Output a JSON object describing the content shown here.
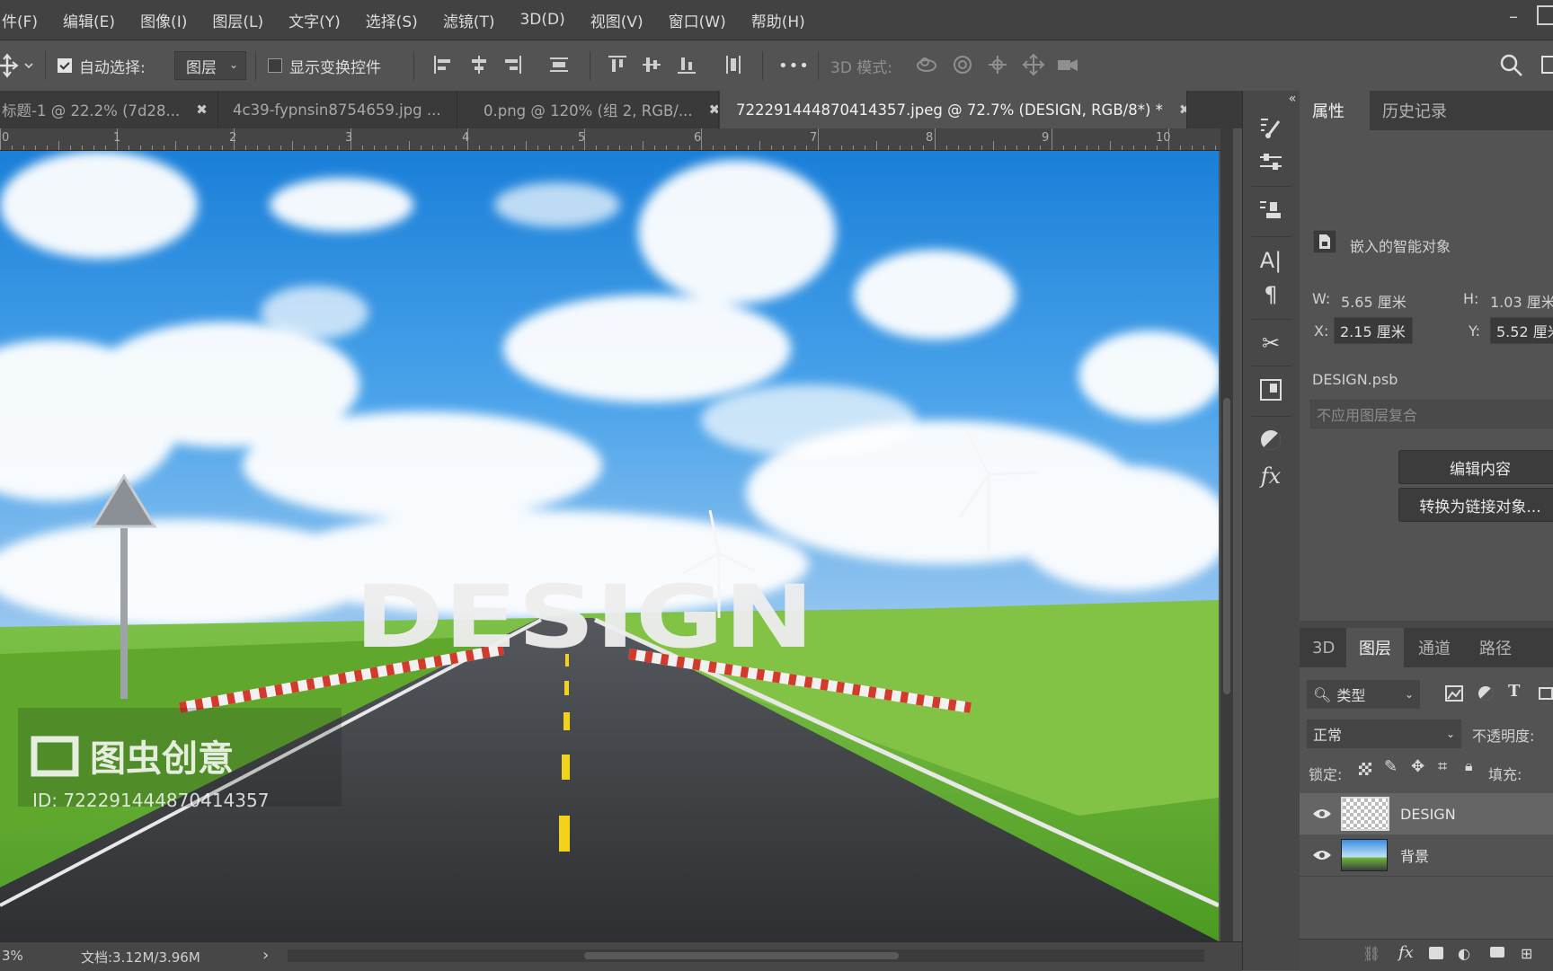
{
  "menu": [
    "件(F)",
    "编辑(E)",
    "图像(I)",
    "图层(L)",
    "文字(Y)",
    "选择(S)",
    "滤镜(T)",
    "3D(D)",
    "视图(V)",
    "窗口(W)",
    "帮助(H)"
  ],
  "options": {
    "auto_select_label": "自动选择:",
    "auto_select_checked": true,
    "target_value": "图层",
    "show_transform_label": "显示变换控件",
    "more_label": "•••",
    "mode_3d_label": "3D 模式:"
  },
  "tabs": [
    {
      "label": "标题-1 @ 22.2% (7d28...",
      "active": false
    },
    {
      "label": "4c39-fypnsin8754659.jpg ...",
      "active": false
    },
    {
      "label": "0.png @ 120% (组 2, RGB/...",
      "active": false
    },
    {
      "label": "722291444870414357.jpeg @ 72.7% (DESIGN, RGB/8*) *",
      "active": true
    }
  ],
  "ruler_numbers": [
    "0",
    "1",
    "2",
    "3",
    "4",
    "5",
    "6",
    "7",
    "8",
    "9",
    "10"
  ],
  "canvas": {
    "road_text": "DESIGN",
    "watermark_brand": "图虫创意",
    "watermark_id": "ID: 722291444870414357"
  },
  "properties_panel": {
    "tab_properties": "属性",
    "tab_history": "历史记录",
    "object_type": "嵌入的智能对象",
    "w_label": "W:",
    "w_value": "5.65 厘米",
    "h_label": "H:",
    "h_value": "1.03 厘米",
    "x_label": "X:",
    "x_value": "2.15 厘米",
    "y_label": "Y:",
    "y_value": "5.52 厘米",
    "file_name": "DESIGN.psb",
    "comp_placeholder": "不应用图层复合",
    "edit_contents_button": "编辑内容",
    "convert_linked_button": "转换为链接对象..."
  },
  "layers_panel": {
    "tabs": [
      "3D",
      "图层",
      "通道",
      "路径"
    ],
    "active_tab": "图层",
    "filter_label": "类型",
    "blend_mode": "正常",
    "opacity_label": "不透明度:",
    "lock_label": "锁定:",
    "fill_label": "填充:",
    "layers": [
      {
        "name": "DESIGN",
        "visible": true,
        "selected": true
      },
      {
        "name": "背景",
        "visible": true,
        "selected": false
      }
    ]
  },
  "status": {
    "zoom": "3%",
    "doc_info": "文档:3.12M/3.96M",
    "arrow": "›"
  },
  "colors": {
    "accent": "#535353",
    "canvas_sky": "#2a8fe0",
    "grass": "#6db33a",
    "road": "#3c3e42",
    "center_line": "#f2d21a"
  }
}
